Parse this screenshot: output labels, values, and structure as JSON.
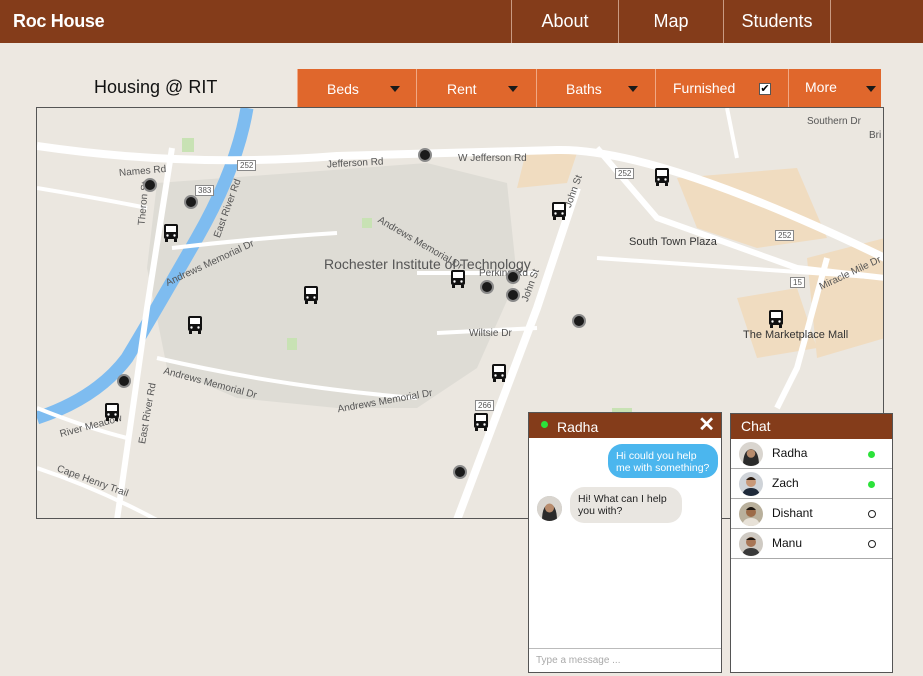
{
  "nav": {
    "brand": "Roc House",
    "links": [
      "About",
      "Map",
      "Students"
    ]
  },
  "page": {
    "title": "Housing @ RIT"
  },
  "filters": {
    "beds": "Beds",
    "rent": "Rent",
    "baths": "Baths",
    "furnished": "Furnished",
    "furnished_checked": true,
    "more": "More"
  },
  "map": {
    "labels": {
      "campus": "Rochester Institute of Technology",
      "south_town_plaza": "South Town Plaza",
      "marketplace_mall": "The Marketplace Mall",
      "jefferson_rd": "Jefferson Rd",
      "w_jefferson_rd": "W Jefferson Rd",
      "john_st_north": "John St",
      "john_st_south": "John St",
      "east_river_rd": "East River Rd",
      "east_river_rd_south": "East River Rd",
      "names_rd": "Names Rd",
      "theron_st": "Theron St",
      "andrews_memorial_dr": "Andrews Memorial Dr",
      "andrews_memorial_dr_2": "Andrews Memorial Dr",
      "andrews_memorial_dr_3": "Andrews Memorial Dr",
      "andrews_memorial_dr_4": "Andrews Memorial Dr",
      "perkins_rd": "Perkins Rd",
      "wiltsie_dr": "Wiltsie Dr",
      "river_meadow": "River Meadow",
      "cape_henry_trail": "Cape Henry Trail",
      "southern_dr": "Southern Dr",
      "miracle_mile_dr": "Miracle Mile Dr",
      "bri": "Bri",
      "route_252_a": "252",
      "route_252_b": "252",
      "route_252_c": "252",
      "route_383": "383",
      "route_266": "266",
      "route_15": "15"
    },
    "housing_pins": 11,
    "bus_stops": 10
  },
  "chat_window": {
    "contact_name": "Radha",
    "messages": [
      {
        "from": "me",
        "text": "Hi could you help me with something?"
      },
      {
        "from": "Radha",
        "text": "Hi! What can I help you with?"
      }
    ],
    "input_placeholder": "Type a message ..."
  },
  "contacts": {
    "title": "Chat",
    "list": [
      {
        "name": "Radha",
        "online": true
      },
      {
        "name": "Zach",
        "online": true
      },
      {
        "name": "Dishant",
        "online": false
      },
      {
        "name": "Manu",
        "online": false
      }
    ]
  },
  "colors": {
    "brand": "#843c1a",
    "accent": "#e0672c",
    "online": "#2ce23a",
    "bubble_out": "#4bb6ee"
  }
}
